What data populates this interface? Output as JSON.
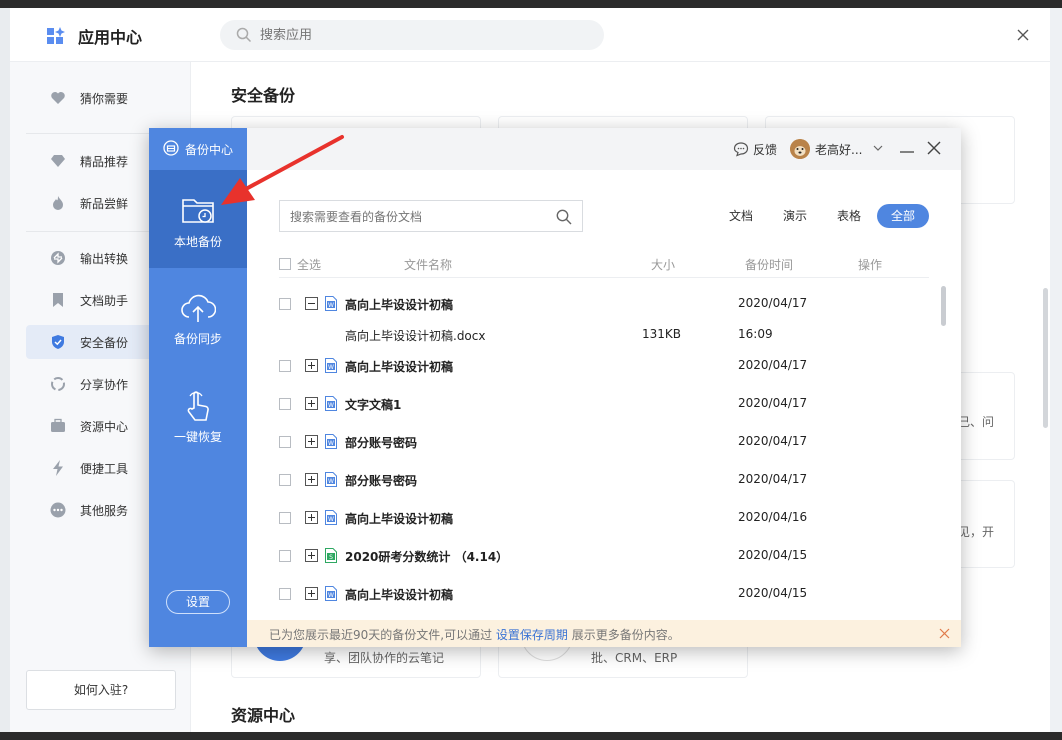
{
  "app": {
    "title": "应用中心",
    "search_placeholder": "搜索应用",
    "join_label": "如何入驻?"
  },
  "sidebar": {
    "items": [
      {
        "label": "猜你需要",
        "icon": "heart-icon"
      },
      {
        "label": "精品推荐",
        "icon": "diamond-icon"
      },
      {
        "label": "新品尝鲜",
        "icon": "flame-icon"
      },
      {
        "label": "输出转换",
        "icon": "convert-icon"
      },
      {
        "label": "文档助手",
        "icon": "bookmark-icon"
      },
      {
        "label": "安全备份",
        "icon": "shield-icon"
      },
      {
        "label": "分享协作",
        "icon": "share-icon"
      },
      {
        "label": "资源中心",
        "icon": "briefcase-icon"
      },
      {
        "label": "便捷工具",
        "icon": "lightning-icon"
      },
      {
        "label": "其他服务",
        "icon": "more-icon"
      }
    ],
    "active_index": 5
  },
  "main": {
    "section1_title": "安全备份",
    "section2_title": "资源中心",
    "card_snippets": [
      "享、团队协作的云笔记",
      "批、CRM、ERP",
      "己、问",
      "见，开"
    ]
  },
  "dialog": {
    "brand": "备份中心",
    "nav": [
      {
        "label": "本地备份",
        "icon": "folder-clock-icon"
      },
      {
        "label": "备份同步",
        "icon": "cloud-upload-icon"
      },
      {
        "label": "一键恢复",
        "icon": "hand-pointer-icon"
      }
    ],
    "settings_label": "设置",
    "feedback_label": "反馈",
    "user_name": "老高好...",
    "search_placeholder": "搜索需要查看的备份文档",
    "filters": [
      "文档",
      "演示",
      "表格",
      "全部"
    ],
    "active_filter": 3,
    "columns": {
      "select_all": "全选",
      "name": "文件名称",
      "size": "大小",
      "time": "备份时间",
      "action": "操作"
    },
    "rows": [
      {
        "name": "高向上毕设设计初稿",
        "size": "",
        "time": "2020/04/17",
        "expanded": true,
        "type": "word"
      },
      {
        "name": "高向上毕设设计初稿.docx",
        "size": "131KB",
        "time": "16:09",
        "child": true
      },
      {
        "name": "高向上毕设设计初稿",
        "size": "",
        "time": "2020/04/17",
        "type": "word"
      },
      {
        "name": "文字文稿1",
        "size": "",
        "time": "2020/04/17",
        "type": "word"
      },
      {
        "name": "部分账号密码",
        "size": "",
        "time": "2020/04/17",
        "type": "word"
      },
      {
        "name": "部分账号密码",
        "size": "",
        "time": "2020/04/17",
        "type": "word"
      },
      {
        "name": "高向上毕设设计初稿",
        "size": "",
        "time": "2020/04/16",
        "type": "word"
      },
      {
        "name": "2020研考分数统计 （4.14）",
        "size": "",
        "time": "2020/04/15",
        "type": "sheet"
      },
      {
        "name": "高向上毕设设计初稿",
        "size": "",
        "time": "2020/04/15",
        "type": "word"
      }
    ],
    "notice_pre": "已为您展示最近90天的备份文件,可以通过",
    "notice_link": "设置保存周期",
    "notice_post": "展示更多备份内容。"
  },
  "colors": {
    "accent": "#4f86e0",
    "accent_dark": "#3a6fc6",
    "arrow": "#e8322c",
    "notice_bg": "#fcf1df"
  }
}
